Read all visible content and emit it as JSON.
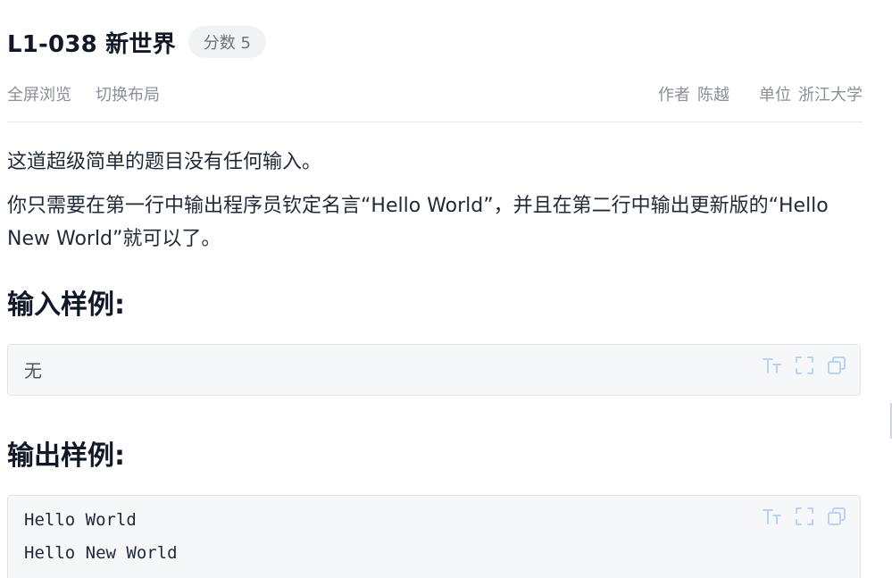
{
  "problem": {
    "title": "L1-038 新世界",
    "score_badge": "分数 5"
  },
  "toolbar": {
    "fullscreen_label": "全屏浏览",
    "switch_layout_label": "切换布局",
    "author_label": "作者",
    "author_value": "陈越",
    "org_label": "单位",
    "org_value": "浙江大学"
  },
  "description": {
    "paragraph_1": "这道超级简单的题目没有任何输入。",
    "paragraph_2": "你只需要在第一行中输出程序员钦定名言“Hello World”，并且在第二行中输出更新版的“Hello New World”就可以了。"
  },
  "sample_input": {
    "heading": "输入样例:",
    "content": "无"
  },
  "sample_output": {
    "heading": "输出样例:",
    "lines": [
      "Hello World",
      "Hello New World"
    ]
  },
  "colors": {
    "icon_accent": "#b8d3f4",
    "muted_text": "#8a8f98",
    "box_background": "#f6f7f8"
  },
  "icons": [
    "font-size-icon",
    "fullscreen-icon",
    "copy-icon"
  ]
}
